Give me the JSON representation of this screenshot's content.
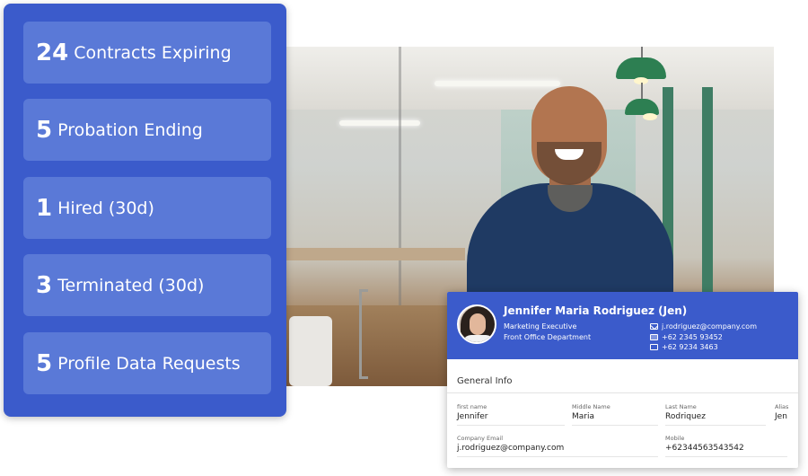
{
  "stats": [
    {
      "count": "24",
      "label": "Contracts Expiring"
    },
    {
      "count": "5",
      "label": "Probation Ending"
    },
    {
      "count": "1",
      "label": "Hired (30d)"
    },
    {
      "count": "3",
      "label": "Terminated (30d)"
    },
    {
      "count": "5",
      "label": "Profile Data Requests"
    }
  ],
  "profile": {
    "name": "Jennifer Maria Rodriguez (Jen)",
    "role": "Marketing Executive",
    "department": "Front Office Department",
    "email": "j.rodriguez@company.com",
    "phone1": "+62 2345 93452",
    "phone2": "+62 9234 3463"
  },
  "general_info": {
    "title": "General Info",
    "first_name_label": "first name",
    "first_name": "Jennifer",
    "middle_name_label": "Middle Name",
    "middle_name": "Maria",
    "last_name_label": "Last Name",
    "last_name": "Rodriquez",
    "alias_label": "Alias",
    "alias": "Jen",
    "company_email_label": "Company Email",
    "company_email": "j.rodriguez@company.com",
    "mobile_label": "Mobile",
    "mobile": "+62344563543542"
  },
  "colors": {
    "panel": "#3b5bcb",
    "card": "#5a79d7"
  },
  "icons": [
    "mail-icon",
    "phone-icon"
  ]
}
